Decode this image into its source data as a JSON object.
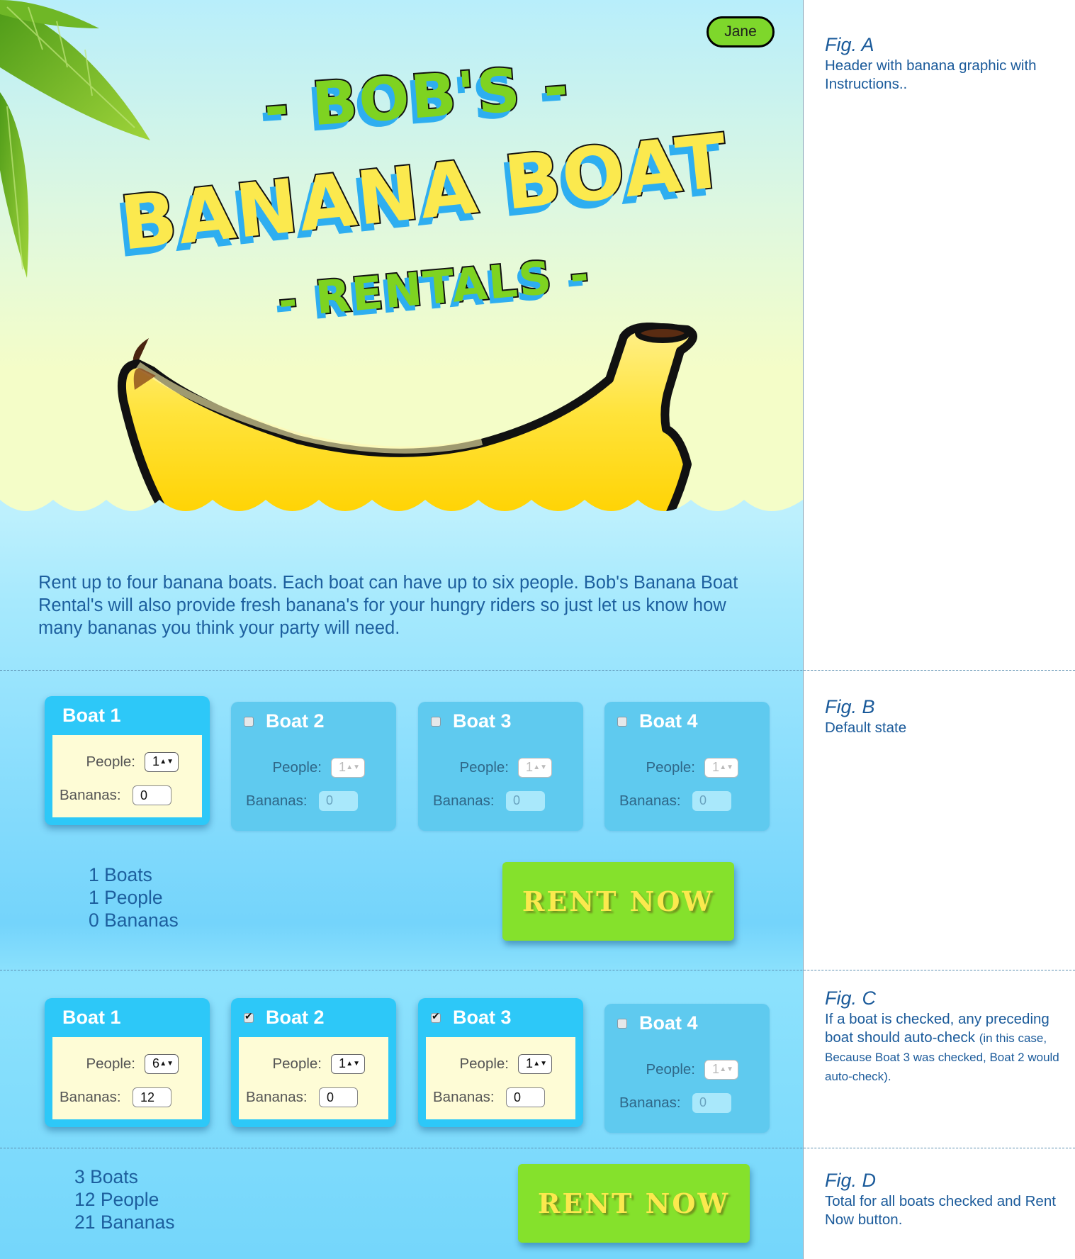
{
  "header": {
    "user_name": "Jane",
    "title_line1": "- BOB'S -",
    "title_line2": "BANANA BOAT",
    "title_line3": "- RENTALS -"
  },
  "intro_text": "Rent up to four banana boats. Each boat can have up to six people. Bob's Banana Boat Rental's will also provide fresh banana's for your hungry riders so just let us know how many bananas you think your party will need.",
  "labels": {
    "people": "People:",
    "bananas": "Bananas:"
  },
  "fig_b": {
    "boats": [
      {
        "name": "Boat 1",
        "people": "1",
        "bananas": "0",
        "state": "active",
        "checkbox": "none"
      },
      {
        "name": "Boat 2",
        "people": "1",
        "bananas": "0",
        "state": "inactive",
        "checkbox": "unchecked"
      },
      {
        "name": "Boat 3",
        "people": "1",
        "bananas": "0",
        "state": "inactive",
        "checkbox": "unchecked"
      },
      {
        "name": "Boat 4",
        "people": "1",
        "bananas": "0",
        "state": "inactive",
        "checkbox": "unchecked"
      }
    ],
    "totals": {
      "boats": "1 Boats",
      "people": "1 People",
      "bananas": "0 Bananas"
    },
    "rent_button": "RENT NOW"
  },
  "fig_c": {
    "boats": [
      {
        "name": "Boat 1",
        "people": "6",
        "bananas": "12",
        "state": "active",
        "checkbox": "none"
      },
      {
        "name": "Boat 2",
        "people": "1",
        "bananas": "0",
        "state": "active",
        "checkbox": "checked"
      },
      {
        "name": "Boat 3",
        "people": "1",
        "bananas": "0",
        "state": "active",
        "checkbox": "checked"
      },
      {
        "name": "Boat 4",
        "people": "1",
        "bananas": "0",
        "state": "inactive",
        "checkbox": "unchecked"
      }
    ]
  },
  "fig_d": {
    "totals": {
      "boats": "3 Boats",
      "people": "12 People",
      "bananas": "21 Bananas"
    },
    "rent_button": "RENT NOW"
  },
  "notes": {
    "a": {
      "fig": "Fig. A",
      "text": "Header with banana graphic with Instructions.."
    },
    "b": {
      "fig": "Fig. B",
      "text": "Default state"
    },
    "c": {
      "fig": "Fig. C",
      "text": "If a boat is checked, any preceding boat should auto-check",
      "small": "(in this case, Because Boat 3 was checked, Boat 2 would auto-check)."
    },
    "d": {
      "fig": "Fig. D",
      "text": "Total for all boats checked and Rent Now button."
    }
  },
  "colors": {
    "accent_green": "#85e12c",
    "banana_yellow": "#fbe94e",
    "boat_active": "#2dc8f8",
    "boat_inactive": "#5fcaef",
    "text_blue": "#1d5f9e"
  }
}
